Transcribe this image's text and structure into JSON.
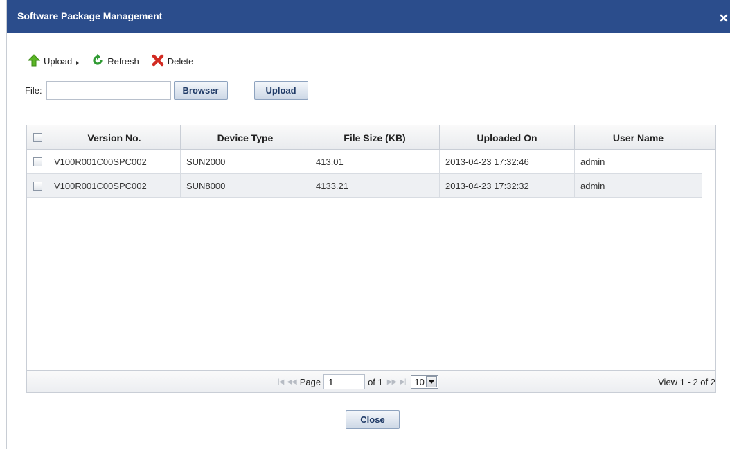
{
  "dialog": {
    "title": "Software Package Management",
    "close_icon": "close-icon"
  },
  "toolbar": {
    "upload_label": "Upload",
    "refresh_label": "Refresh",
    "delete_label": "Delete"
  },
  "file": {
    "label": "File:",
    "value": "",
    "browse_label": "Browser",
    "upload_label": "Upload"
  },
  "table": {
    "columns": [
      "Version No.",
      "Device Type",
      "File Size (KB)",
      "Uploaded On",
      "User Name"
    ],
    "rows": [
      {
        "version": "V100R001C00SPC002",
        "device": "SUN2000",
        "size": "413.01",
        "uploaded": "2013-04-23 17:32:46",
        "user": "admin"
      },
      {
        "version": "V100R001C00SPC002",
        "device": "SUN8000",
        "size": "4133.21",
        "uploaded": "2013-04-23 17:32:32",
        "user": "admin"
      }
    ]
  },
  "pager": {
    "page_label": "Page",
    "page_value": "1",
    "of_label": "of 1",
    "rows_per_page": "10",
    "view_info": "View 1 - 2 of 2"
  },
  "footer": {
    "close_label": "Close"
  },
  "colors": {
    "titlebar": "#2b4d8c",
    "button_text": "#1f3a66"
  }
}
